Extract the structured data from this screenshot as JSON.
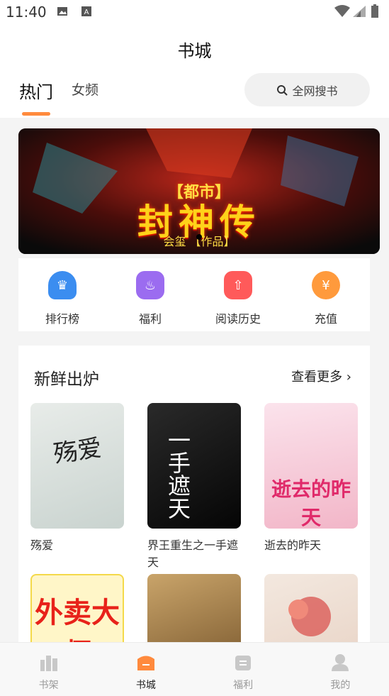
{
  "status_bar": {
    "time": "11:40"
  },
  "header": {
    "title": "书城"
  },
  "tabs": [
    {
      "label": "热门"
    },
    {
      "label": "女频"
    }
  ],
  "search": {
    "label": "全网搜书"
  },
  "banner": {
    "title": "封神传",
    "subtitle": "【都市】",
    "author": "会玺 【作品】"
  },
  "quick_links": [
    {
      "label": "排行榜",
      "icon": "trophy-icon",
      "color": "#3b8df0"
    },
    {
      "label": "福利",
      "icon": "gift-icon",
      "color": "#9b6cf0"
    },
    {
      "label": "阅读历史",
      "icon": "history-icon",
      "color": "#ff5a5a"
    },
    {
      "label": "充值",
      "icon": "coin-icon",
      "color": "#ff9a3c"
    }
  ],
  "section": {
    "title": "新鲜出炉",
    "more": "查看更多 ›",
    "books": [
      {
        "title": "殇爱",
        "cover_text": "殇爱"
      },
      {
        "title": "界王重生之一手遮天",
        "cover_text": "一手遮天"
      },
      {
        "title": "逝去的昨天",
        "cover_text": "逝去的昨天"
      },
      {
        "title": "",
        "cover_text": "外卖大师"
      },
      {
        "title": "",
        "cover_text": ""
      },
      {
        "title": "",
        "cover_text": ""
      }
    ]
  },
  "bottom_nav": [
    {
      "label": "书架",
      "active": false
    },
    {
      "label": "书城",
      "active": true
    },
    {
      "label": "福利",
      "active": false
    },
    {
      "label": "我的",
      "active": false
    }
  ],
  "colors": {
    "accent": "#ff8a3d",
    "muted": "#999999"
  }
}
